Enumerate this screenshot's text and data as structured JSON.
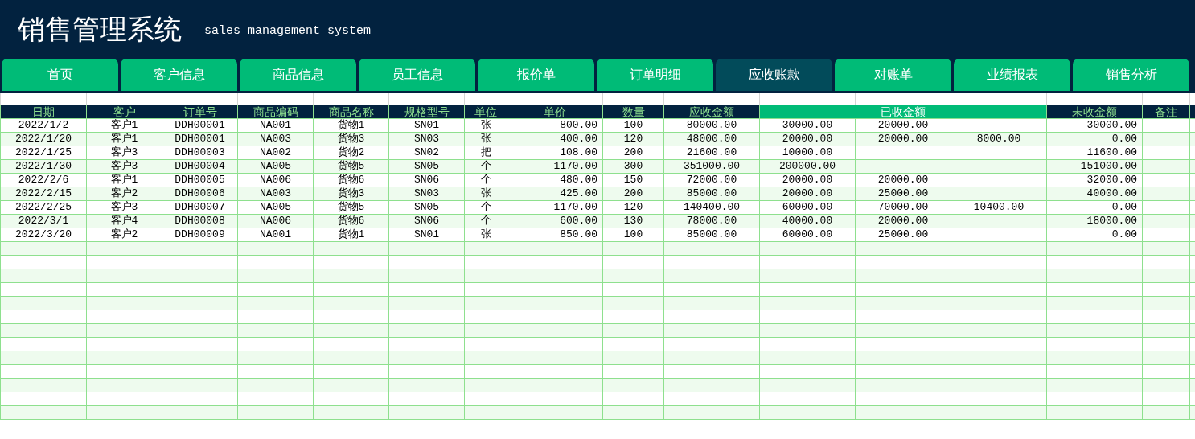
{
  "header": {
    "title": "销售管理系统",
    "subtitle": "sales management system"
  },
  "tabs": [
    {
      "label": "首页",
      "selected": false
    },
    {
      "label": "客户信息",
      "selected": false
    },
    {
      "label": "商品信息",
      "selected": false
    },
    {
      "label": "员工信息",
      "selected": false
    },
    {
      "label": "报价单",
      "selected": false
    },
    {
      "label": "订单明细",
      "selected": false
    },
    {
      "label": "应收账款",
      "selected": true
    },
    {
      "label": "对账单",
      "selected": false
    },
    {
      "label": "业绩报表",
      "selected": false
    },
    {
      "label": "销售分析",
      "selected": false
    }
  ],
  "table": {
    "columns": [
      {
        "label": "日期",
        "kind": "single"
      },
      {
        "label": "客户",
        "kind": "single"
      },
      {
        "label": "订单号",
        "kind": "single"
      },
      {
        "label": "商品编码",
        "kind": "single"
      },
      {
        "label": "商品名称",
        "kind": "single"
      },
      {
        "label": "规格型号",
        "kind": "single"
      },
      {
        "label": "单位",
        "kind": "single"
      },
      {
        "label": "单价",
        "kind": "single"
      },
      {
        "label": "数量",
        "kind": "single"
      },
      {
        "label": "应收金额",
        "kind": "single"
      },
      {
        "label": "已收金额",
        "kind": "group",
        "colspan": 3
      },
      {
        "label": "未收金额",
        "kind": "single"
      },
      {
        "label": "备注",
        "kind": "single"
      }
    ],
    "rows": [
      [
        "2022/1/2",
        "客户1",
        "DDH00001",
        "NA001",
        "货物1",
        "SN01",
        "张",
        "800.00",
        "100",
        "80000.00",
        "30000.00",
        "20000.00",
        null,
        "30000.00",
        null
      ],
      [
        "2022/1/20",
        "客户1",
        "DDH00001",
        "NA003",
        "货物3",
        "SN03",
        "张",
        "400.00",
        "120",
        "48000.00",
        "20000.00",
        "20000.00",
        "8000.00",
        "0.00",
        null
      ],
      [
        "2022/1/25",
        "客户3",
        "DDH00003",
        "NA002",
        "货物2",
        "SN02",
        "把",
        "108.00",
        "200",
        "21600.00",
        "10000.00",
        null,
        null,
        "11600.00",
        null
      ],
      [
        "2022/1/30",
        "客户3",
        "DDH00004",
        "NA005",
        "货物5",
        "SN05",
        "个",
        "1170.00",
        "300",
        "351000.00",
        "200000.00",
        null,
        null,
        "151000.00",
        null
      ],
      [
        "2022/2/6",
        "客户1",
        "DDH00005",
        "NA006",
        "货物6",
        "SN06",
        "个",
        "480.00",
        "150",
        "72000.00",
        "20000.00",
        "20000.00",
        null,
        "32000.00",
        null
      ],
      [
        "2022/2/15",
        "客户2",
        "DDH00006",
        "NA003",
        "货物3",
        "SN03",
        "张",
        "425.00",
        "200",
        "85000.00",
        "20000.00",
        "25000.00",
        null,
        "40000.00",
        null
      ],
      [
        "2022/2/25",
        "客户3",
        "DDH00007",
        "NA005",
        "货物5",
        "SN05",
        "个",
        "1170.00",
        "120",
        "140400.00",
        "60000.00",
        "70000.00",
        "10400.00",
        "0.00",
        null
      ],
      [
        "2022/3/1",
        "客户4",
        "DDH00008",
        "NA006",
        "货物6",
        "SN06",
        "个",
        "600.00",
        "130",
        "78000.00",
        "40000.00",
        "20000.00",
        null,
        "18000.00",
        null
      ],
      [
        "2022/3/20",
        "客户2",
        "DDH00009",
        "NA001",
        "货物1",
        "SN01",
        "张",
        "850.00",
        "100",
        "85000.00",
        "60000.00",
        "25000.00",
        null,
        "0.00",
        null
      ]
    ]
  }
}
